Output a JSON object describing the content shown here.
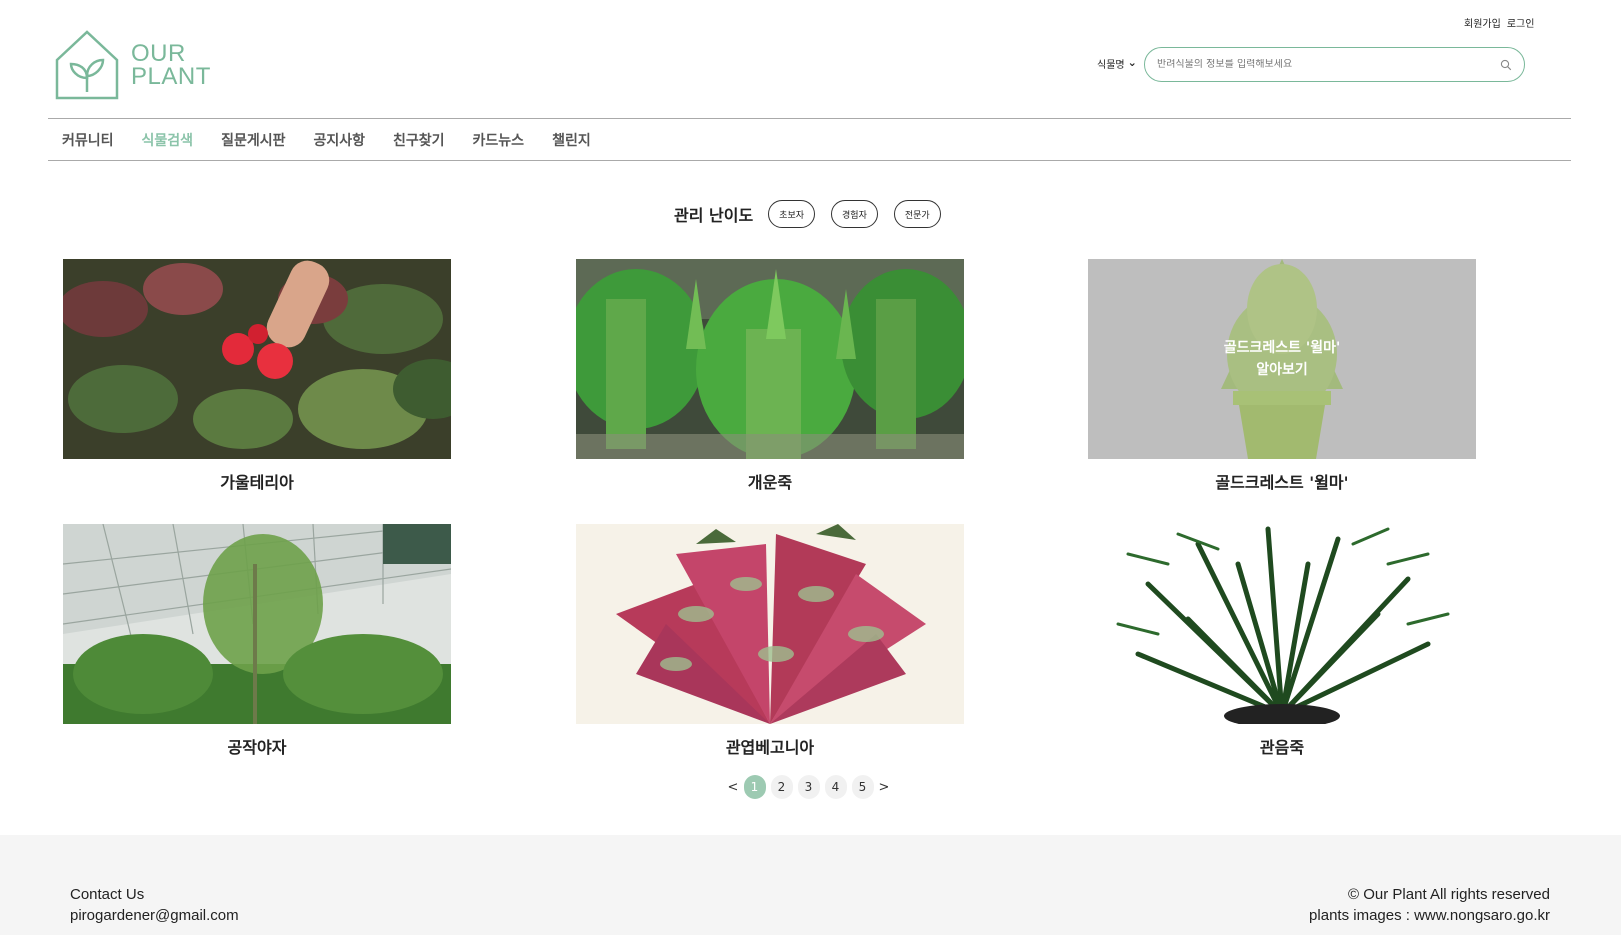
{
  "header": {
    "auth": {
      "signup": "회원가입",
      "login": "로그인"
    },
    "logo": {
      "line1": "OUR",
      "line2": "PLANT"
    },
    "search": {
      "select_value": "식물명",
      "placeholder": "반려식물의 정보를 입력해보세요"
    }
  },
  "nav": {
    "items": [
      {
        "label": "커뮤니티"
      },
      {
        "label": "식물검색"
      },
      {
        "label": "질문게시판"
      },
      {
        "label": "공지사항"
      },
      {
        "label": "친구찾기"
      },
      {
        "label": "카드뉴스"
      },
      {
        "label": "챌린지"
      }
    ],
    "active_index": 1
  },
  "filter": {
    "label": "관리 난이도",
    "options": [
      "초보자",
      "경험자",
      "전문가"
    ]
  },
  "plants": [
    {
      "name": "가울테리아"
    },
    {
      "name": "개운죽"
    },
    {
      "name": "골드크레스트 '윌마'",
      "overlay_line1": "골드크레스트 '윌마'",
      "overlay_line2": "알아보기"
    },
    {
      "name": "공작야자"
    },
    {
      "name": "관엽베고니아"
    },
    {
      "name": "관음죽"
    }
  ],
  "pagination": {
    "prev": "<",
    "next": ">",
    "pages": [
      "1",
      "2",
      "3",
      "4",
      "5"
    ],
    "current": "1"
  },
  "footer": {
    "contact_title": "Contact Us",
    "contact_email": "pirogardener@gmail.com",
    "copyright": "© Our Plant All rights reserved",
    "images_credit": "plants images : www.nongsaro.go.kr"
  },
  "colors": {
    "accent": "#7ab89a",
    "nav_active": "#8cc4aa",
    "page_active": "#9dcab2",
    "footer_bg": "#f5f5f5"
  }
}
